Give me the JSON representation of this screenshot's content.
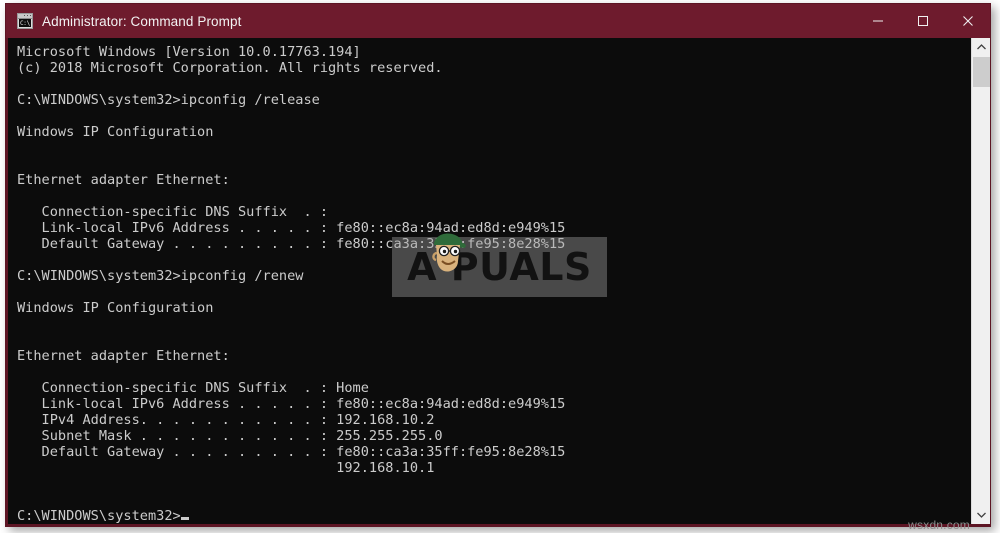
{
  "window": {
    "title": "Administrator: Command Prompt",
    "icon_name": "command-prompt-icon",
    "icon_glyph": "C:\\.",
    "titlebar_color": "#6e1b2d",
    "terminal_bg": "#0c0c0c",
    "terminal_fg": "#cccccc",
    "controls": {
      "minimize_label": "Minimize",
      "maximize_label": "Maximize",
      "close_label": "Close"
    }
  },
  "terminal": {
    "lines": [
      "Microsoft Windows [Version 10.0.17763.194]",
      "(c) 2018 Microsoft Corporation. All rights reserved.",
      "",
      "C:\\WINDOWS\\system32>ipconfig /release",
      "",
      "Windows IP Configuration",
      "",
      "",
      "Ethernet adapter Ethernet:",
      "",
      "   Connection-specific DNS Suffix  . :",
      "   Link-local IPv6 Address . . . . . : fe80::ec8a:94ad:ed8d:e949%15",
      "   Default Gateway . . . . . . . . . : fe80::ca3a:35ff:fe95:8e28%15",
      "",
      "C:\\WINDOWS\\system32>ipconfig /renew",
      "",
      "Windows IP Configuration",
      "",
      "",
      "Ethernet adapter Ethernet:",
      "",
      "   Connection-specific DNS Suffix  . : Home",
      "   Link-local IPv6 Address . . . . . : fe80::ec8a:94ad:ed8d:e949%15",
      "   IPv4 Address. . . . . . . . . . . : 192.168.10.2",
      "   Subnet Mask . . . . . . . . . . . : 255.255.255.0",
      "   Default Gateway . . . . . . . . . : fe80::ca3a:35ff:fe95:8e28%15",
      "                                       192.168.10.1",
      "",
      ""
    ],
    "prompt": "C:\\WINDOWS\\system32>",
    "commands": [
      "ipconfig /release",
      "ipconfig /renew"
    ],
    "network_values": {
      "connection_specific_dns_suffix_before": "",
      "connection_specific_dns_suffix_after": "Home",
      "link_local_ipv6_address": "fe80::ec8a:94ad:ed8d:e949%15",
      "ipv4_address": "192.168.10.2",
      "subnet_mask": "255.255.255.0",
      "default_gateway_ipv6": "fe80::ca3a:35ff:fe95:8e28%15",
      "default_gateway_ipv4": "192.168.10.1"
    }
  },
  "scrollbar": {
    "up_arrow": "▲",
    "down_arrow": "▼"
  },
  "watermarks": {
    "center_logo_text": "A  PUALS",
    "center_logo_name": "appuals-logo",
    "corner_text": "wsxdn.com"
  }
}
